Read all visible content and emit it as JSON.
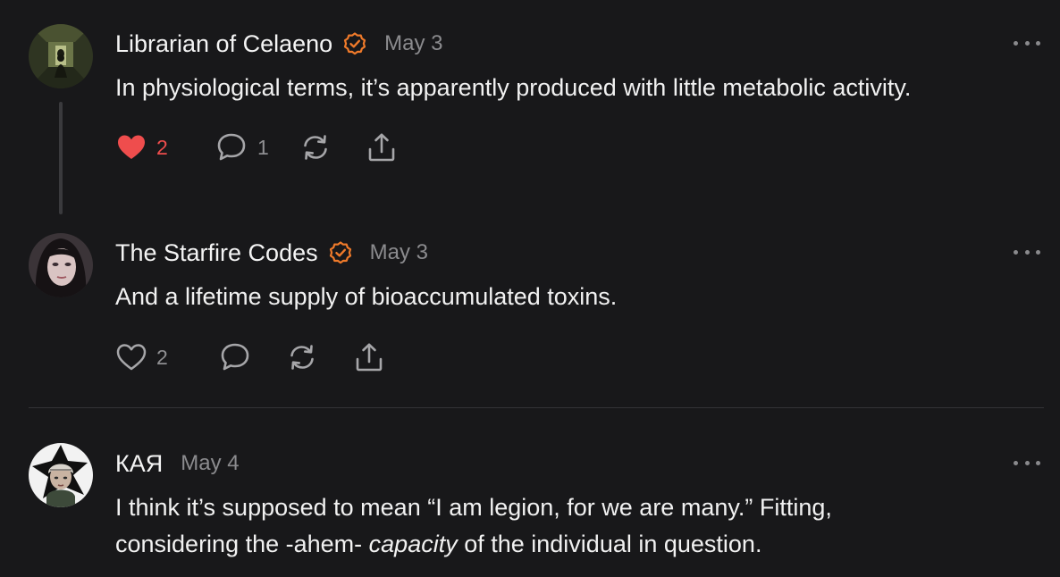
{
  "colors": {
    "background": "#18181a",
    "verified_orange": "#ef7a2a",
    "liked_red": "#ef4d4d",
    "muted": "#8f8f92"
  },
  "comments": [
    {
      "author": "Librarian of Celaeno",
      "verified": true,
      "date": "May 3",
      "text": "In physiological terms, it’s apparently produced with little metabolic activity.",
      "like_count": "2",
      "liked": true,
      "reply_count": "1",
      "avatar_icon": "hallway-figure-avatar"
    },
    {
      "author": "The Starfire Codes",
      "verified": true,
      "date": "May 3",
      "text": "And a lifetime supply of bioaccumulated toxins.",
      "like_count": "2",
      "liked": false,
      "reply_count": "",
      "avatar_icon": "portrait-avatar"
    },
    {
      "author": "КАЯ",
      "verified": false,
      "date": "May 4",
      "text_plain_1": "I think it’s supposed to mean “I am legion, for we are many.” Fitting,",
      "text_plain_2": "considering the -ahem- ",
      "text_italic": "capacity",
      "text_plain_3": " of the individual in question.",
      "avatar_icon": "illustrated-character-avatar"
    }
  ],
  "icons": {
    "like": "heart-icon",
    "reply": "comment-bubble-icon",
    "restack": "restack-icon",
    "share": "share-icon",
    "more": "more-options-icon",
    "verified": "verified-badge-icon"
  }
}
